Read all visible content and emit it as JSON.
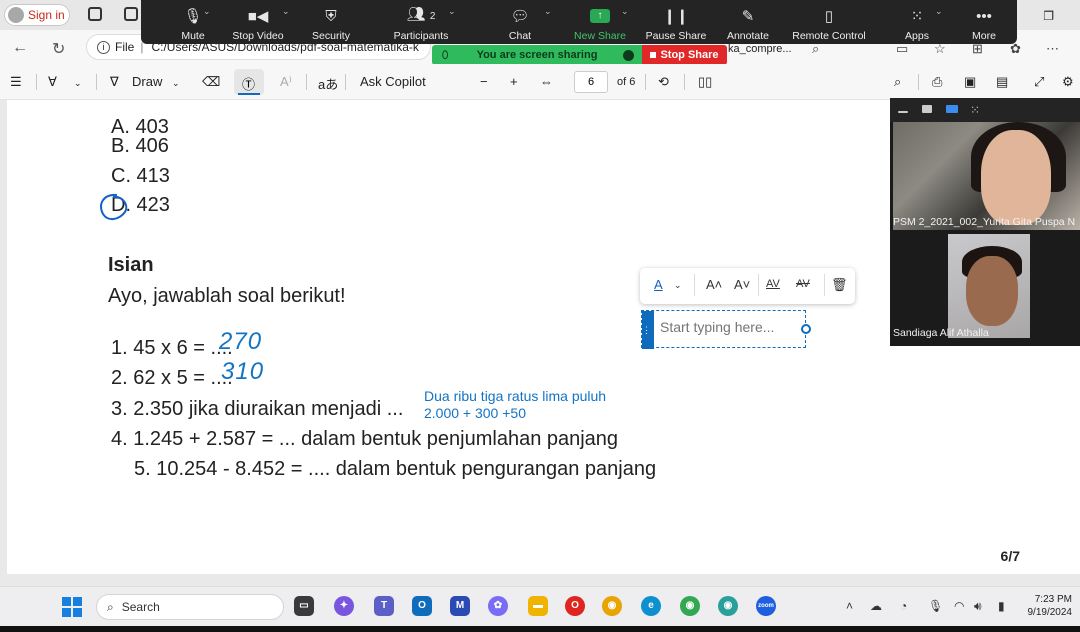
{
  "browser": {
    "sign_in_label": "Sign in",
    "address_file": "File",
    "address_path": "C:/Users/ASUS/Downloads/pdf-soal-matematika-k",
    "address_tail": "ka_compre..."
  },
  "zoom": {
    "buttons": [
      {
        "label": "Mute",
        "icon": "microphone-icon"
      },
      {
        "label": "Stop Video",
        "icon": "video-camera-icon"
      },
      {
        "label": "Security",
        "icon": "shield-icon"
      },
      {
        "label": "Participants",
        "icon": "participants-icon",
        "count": "2"
      },
      {
        "label": "Chat",
        "icon": "chat-icon"
      },
      {
        "label": "New Share",
        "icon": "share-icon"
      },
      {
        "label": "Pause Share",
        "icon": "pause-icon"
      },
      {
        "label": "Annotate",
        "icon": "pencil-icon"
      },
      {
        "label": "Remote Control",
        "icon": "mouse-icon"
      },
      {
        "label": "Apps",
        "icon": "apps-icon"
      },
      {
        "label": "More",
        "icon": "more-icon"
      }
    ],
    "sharing_status": "You are screen sharing",
    "stop_share_label": "Stop Share",
    "participants": [
      {
        "name": "PSM 2_2021_002_Yurita Gita Puspa N"
      },
      {
        "name": "Sandiaga Alif Athalla"
      }
    ]
  },
  "pdf_toolbar": {
    "draw_label": "Draw",
    "ask_copilot_label": "Ask Copilot",
    "page_current": "6",
    "page_total": "of 6"
  },
  "document": {
    "options": [
      "A. 403",
      "B. 406",
      "C. 413",
      "D. 423"
    ],
    "section_title": "Isian",
    "instruction": "Ayo, jawablah soal berikut!",
    "questions": [
      "1. 45 x 6 = ....",
      "2. 62 x 5 = ....",
      "3. 2.350 jika diuraikan menjadi ...",
      "4. 1.245 + 2.587 = ... dalam bentuk penjumlahan panjang",
      "5. 10.254 - 8.452 = .... dalam bentuk pengurangan panjang"
    ],
    "handwritten_answers": [
      "270",
      "310"
    ],
    "typed_annotations": [
      "Dua ribu tiga ratus lima puluh",
      "2.000 + 300 +50"
    ],
    "text_box_placeholder": "Start typing here...",
    "page_indicator": "6/7"
  },
  "taskbar": {
    "search_label": "Search",
    "time": "7:23 PM",
    "date": "9/19/2024"
  }
}
